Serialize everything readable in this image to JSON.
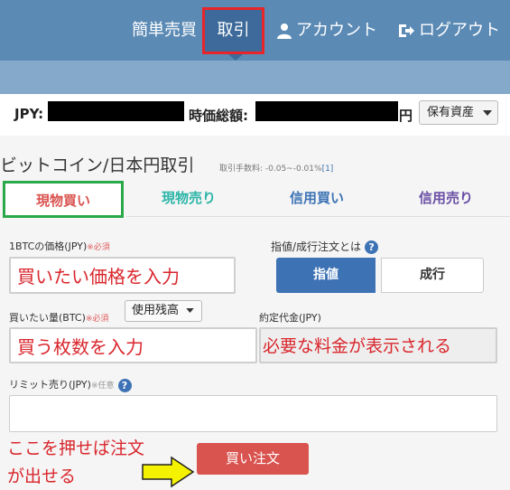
{
  "nav": {
    "simple_trade": "簡単売買",
    "trade": "取引",
    "account": "アカウント",
    "logout": "ログアウト"
  },
  "balance": {
    "jpy_label": "JPY:",
    "total_label": "時価総額:",
    "yen_suffix": "円",
    "assets_button": "保有資産"
  },
  "page": {
    "title": "ビットコイン/日本円取引",
    "fee_text": "取引手数料: -0.05~-0.01%",
    "fee_link": "[1]"
  },
  "tabs": [
    "現物買い",
    "現物売り",
    "信用買い",
    "信用売り"
  ],
  "form": {
    "price_label": "1BTCの価格(JPY)",
    "price_required": "※必須",
    "price_annotation": "買いたい価格を入力",
    "order_type_label": "指値/成行注文とは",
    "limit_button": "指値",
    "market_button": "成行",
    "amount_label": "買いたい量(BTC)",
    "amount_required": "※必須",
    "use_balance": "使用残高",
    "amount_annotation": "買う枚数を入力",
    "contract_label": "約定代金(JPY)",
    "contract_annotation": "必要な料金が表示される",
    "limit_sell_label": "リミット売り(JPY)",
    "limit_sell_optional": "※任意",
    "help_glyph": "?",
    "buy_button": "買い注文"
  },
  "annotations": {
    "press_line1": "ここを押せば注文",
    "press_line2": "が出せる"
  },
  "colors": {
    "header": "#5b8ab5",
    "active_nav_border": "#e8252a",
    "active_tab_border": "#2aa84a",
    "buy_button": "#d9534f",
    "annotation_text": "#d9262c",
    "arrow": "#f5f200"
  },
  "icons": {
    "account": "user-icon",
    "logout": "logout-icon",
    "help": "question-circle-icon",
    "dropdown": "caret-down-icon",
    "pointer": "yellow-arrow-icon"
  }
}
